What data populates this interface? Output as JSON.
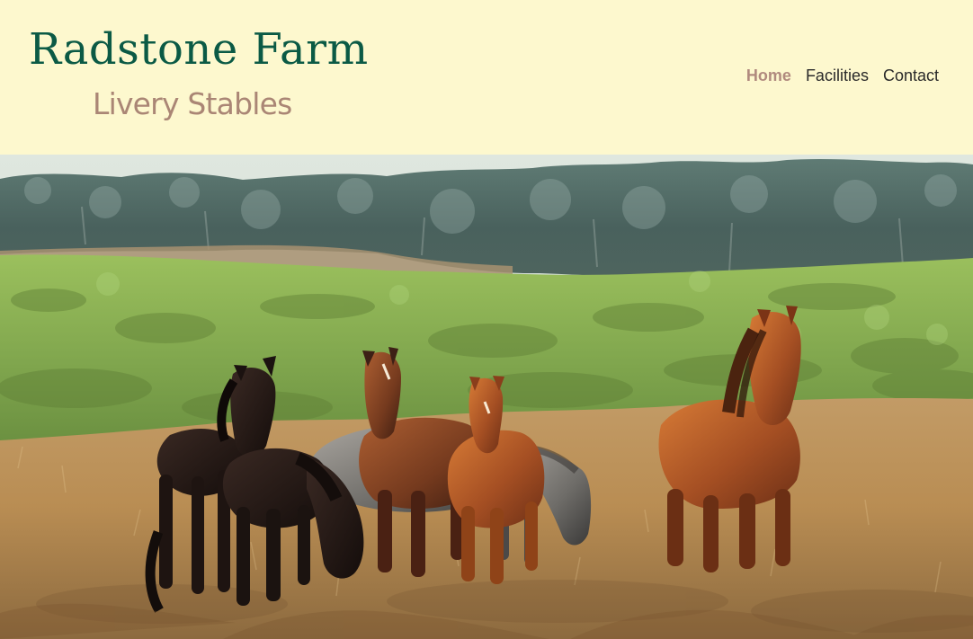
{
  "site": {
    "title": "Radstone Farm",
    "subtitle": "Livery Stables"
  },
  "nav": {
    "items": [
      {
        "label": "Home",
        "active": true
      },
      {
        "label": "Facilities",
        "active": false
      },
      {
        "label": "Contact",
        "active": false
      }
    ]
  },
  "colors": {
    "header_background": "#fdf8ce",
    "title": "#0b5a45",
    "subtitle": "#aa8675",
    "nav_active": "#b08a7e",
    "nav_text": "#2a2a2a"
  }
}
